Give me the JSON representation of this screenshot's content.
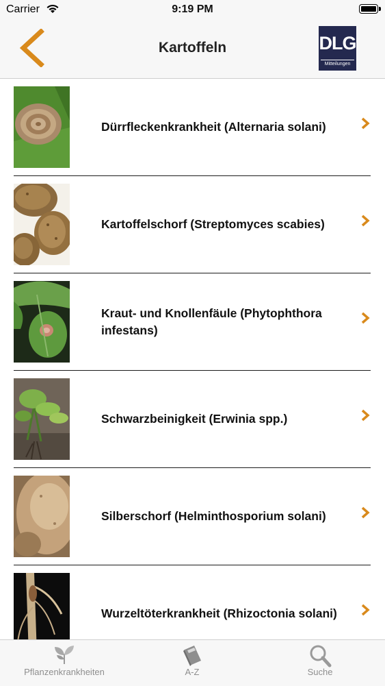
{
  "status_bar": {
    "carrier": "Carrier",
    "time": "9:19 PM"
  },
  "nav": {
    "title": "Kartoffeln",
    "logo_text": "DLG",
    "logo_subtext": "Mitteilungen",
    "logo_color": "#24294f",
    "accent_color": "#d98a1c"
  },
  "diseases": [
    {
      "title": "Dürrfleckenkrankheit (Alternaria solani)",
      "image": "leaf-lesion-photo"
    },
    {
      "title": "Kartoffelschorf (Streptomyces scabies)",
      "image": "potato-scab-photo"
    },
    {
      "title": "Kraut- und Knollenfäule (Phytophthora infestans)",
      "image": "leaf-blight-photo"
    },
    {
      "title": "Schwarzbeinigkeit (Erwinia spp.)",
      "image": "wilted-plant-photo"
    },
    {
      "title": "Silberschorf (Helminthosporium solani)",
      "image": "silver-scurf-photo"
    },
    {
      "title": "Wurzeltöterkrankheit (Rhizoctonia solani)",
      "image": "rhizoctonia-stem-photo"
    }
  ],
  "tabs": [
    {
      "label": "Pflanzenkrankheiten",
      "icon": "plant-icon",
      "selected": true
    },
    {
      "label": "A-Z",
      "icon": "book-icon",
      "selected": false
    },
    {
      "label": "Suche",
      "icon": "search-icon",
      "selected": false
    }
  ]
}
